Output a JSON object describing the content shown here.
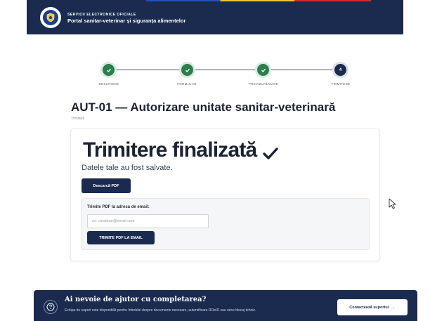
{
  "header": {
    "top_label": "SERVICII ELECTRONICE OFICIALE",
    "subtitle": "Portal sanitar-veterinar și siguranța alimentelor",
    "logo_icon": "coat-of-arms-icon"
  },
  "stepper": {
    "steps": [
      {
        "label": "DESCRIERE",
        "status": "done",
        "icon": "check-icon"
      },
      {
        "label": "FORMULAR",
        "status": "done",
        "icon": "check-icon"
      },
      {
        "label": "PREVIZUALIZARE",
        "status": "done",
        "icon": "check-icon"
      },
      {
        "label": "TRIMITERE",
        "status": "current",
        "number": "4"
      }
    ]
  },
  "page": {
    "title": "AUT-01 — Autorizare unitate sanitar-veterinară",
    "subtitle": "Trimitere"
  },
  "card": {
    "success_title": "Trimitere finalizată",
    "saved_text": "Datele tale au fost salvate.",
    "download_label": "Descarcă PDF",
    "email": {
      "label": "Trimite PDF la adresa de email:",
      "placeholder": "ex: cetatean@email.com",
      "value": "",
      "send_label": "TRIMITE PDF LA EMAIL"
    }
  },
  "help": {
    "title": "Ai nevoie de ajutor cu completarea?",
    "text": "Echipa de suport este disponibilă pentru întrebări despre documente necesare, autentificare ROeID sau orice blocaj tehnic.",
    "contact_label": "Contactează suportul",
    "contact_arrow": "→"
  },
  "colors": {
    "navy": "#1a2b4f",
    "done_green": "#2e7d4f"
  }
}
